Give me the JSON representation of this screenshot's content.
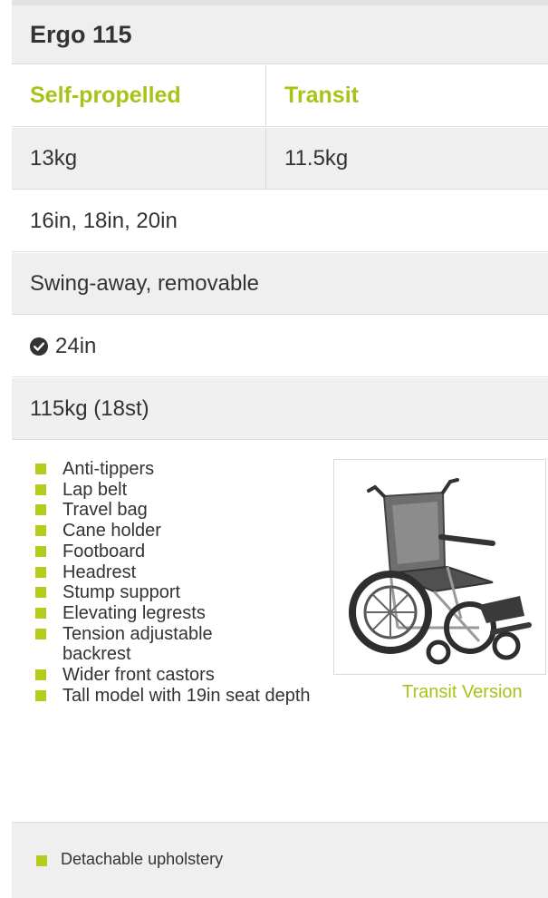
{
  "product": {
    "name": "Ergo 115"
  },
  "columns": {
    "col1": "Self-propelled",
    "col2": "Transit"
  },
  "weights": {
    "self_propelled": "13kg",
    "transit": "11.5kg"
  },
  "seat_widths": "16in, 18in, 20in",
  "armrests": "Swing-away, removable",
  "overall_width": {
    "icon": "check-circle-icon",
    "value": "24in"
  },
  "max_user_weight": "115kg (18st)",
  "features": [
    "Anti-tippers",
    "Lap belt",
    "Travel bag",
    "Cane holder",
    "Footboard",
    "Headrest",
    "Stump support",
    "Elevating legrests",
    "Tension adjustable backrest",
    "Wider front castors",
    "Tall model with 19in seat depth"
  ],
  "image": {
    "caption": "Transit Version",
    "icon": "wheelchair-image"
  },
  "extras": [
    "Detachable upholstery"
  ],
  "colors": {
    "accent": "#a7c31a",
    "bullet": "#b5cc1c",
    "row_shaded": "#efefef",
    "text": "#333333"
  }
}
